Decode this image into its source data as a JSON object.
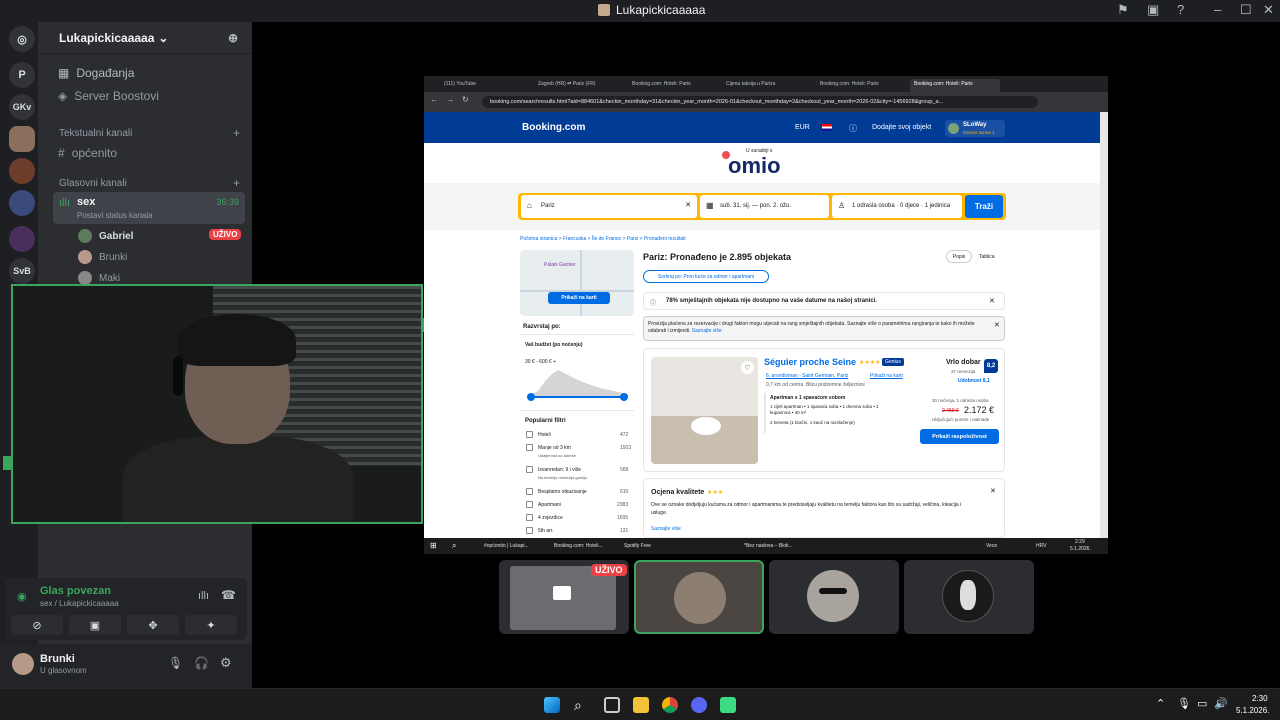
{
  "window": {
    "title": "Lukapickicaaaaa"
  },
  "servers": [
    "P",
    "GKv",
    "SvB"
  ],
  "guild": {
    "name": "Lukapickicaaaaa"
  },
  "channels": {
    "events": "Događanja",
    "boosts": "Server Boostovi",
    "text_category": "Tekstualni kanali",
    "text_channel": "općenito",
    "voice_category": "Glasovni kanali",
    "voice_channel": "sex",
    "voice_time": "36:39",
    "voice_status": "Postavi status kanala",
    "members": [
      {
        "name": "Gabriel",
        "badge": "UŽIVO"
      },
      {
        "name": "Brunki"
      },
      {
        "name": "Maki"
      }
    ]
  },
  "voice_panel": {
    "status": "Glas povezan",
    "location": "sex / Lukapickicaaaaa"
  },
  "user": {
    "name": "Brunki",
    "status": "U glasovnom"
  },
  "browser": {
    "tabs": [
      "(111) YouTube",
      "Zagreb (HR) ⇄ Pariz (FR)",
      "Booking.com: Hoteli: Paris",
      "Cijena taksija u Parizu",
      "Booking.com: Hoteli: Paris",
      "Booking.com: Hoteli: Paris"
    ],
    "url": "booking.com/searchresults.html?aid=884601&checkin_monthday=31&checkin_year_month=2026-01&checkout_monthday=2&checkout_year_month=2026-02&city=-1456928&group_a..."
  },
  "booking": {
    "logo": "Booking.com",
    "currency": "EUR",
    "list_property": "Dodajte svoj objekt",
    "account_name": "SLoWay",
    "account_level": "Genius razina 1",
    "partner_label": "U suradnji s",
    "partner_logo": "omio",
    "search": {
      "destination": "Pariz",
      "dates": "sub. 31. sij.  —  pon. 2. ožu.",
      "guests": "1 odrasla osoba · 0 djece · 1 jedinica",
      "submit": "Traži"
    },
    "breadcrumb": "Početna stranica > Francuska > Île de France > Pariz > Pronađeni rezultati",
    "map_button": "Prikaži na karti",
    "map_label": "Palais Garnier",
    "results_title": "Pariz: Pronađeno je 2.895 objekata",
    "sort": "Sortiraj po: Prvo kuće za odmor i apartmani",
    "view_toggle": [
      "Popis",
      "Tablica"
    ],
    "alert": "78% smještajnih objekata nije dostupno na vaše datume na našoj stranici.",
    "notice": "Provizija plaćena za rezervacije i drugi faktori mogu utjecati na rang smještajnih objekata. Saznajte više o parametrima rangiranja te kako ih možete odabrati i izmijeniti.",
    "notice_link": "Saznajte više",
    "filters": {
      "heading": "Razvrstaj po:",
      "budget": "Vaš budžet (po noćenju)",
      "budget_range": "30 € - 600 € +",
      "popular": "Popularni filtri",
      "items": [
        {
          "label": "Hoteli",
          "count": "472"
        },
        {
          "label": "Manje od 3 km",
          "count": "1503",
          "sub": "Udaljenost od adrese"
        },
        {
          "label": "Izvanredan: 9 i više",
          "count": "568",
          "sub": "Na temelju recenzija gostiju"
        },
        {
          "label": "Besplatno otkazivanje",
          "count": "610"
        },
        {
          "label": "Apartmani",
          "count": "2383"
        },
        {
          "label": "4 zvjezdice",
          "count": "1695"
        },
        {
          "label": "5th arr.",
          "count": "131"
        }
      ]
    },
    "property": {
      "name": "Séguier proche Seine",
      "genius": "Genius",
      "address": "6. arondisman - Saint Germain, Pariz",
      "map_link": "Prikaži na karti",
      "distance": "0,7 km od centra",
      "transit": "Blizu podzemne željeznice",
      "room": "Apartman s 1 spavaćom sobom",
      "details": "1 cijeli apartman • 1 spavaća soba • 1 dnevna soba • 1 kupaonica • 40 m²",
      "beds": "2 kreveta (1 bračni, 1 kauč na razvlačenje)",
      "rating_word": "Vrlo dobar",
      "reviews": "37 recenzija",
      "score": "8,2",
      "location_score": "Udobnost 8,1",
      "stay": "30 noćenja, 1 odrasla osoba",
      "old_price": "2.459 €",
      "price": "2.172 €",
      "taxes": "Uključujući poreze i naknade",
      "cta": "Prikaži raspoloživost"
    },
    "quality": {
      "title": "Ocjena kvalitete",
      "text": "Ove se oznake dodjeljuju kućama za odmor i apartmanima te predstavljaju kvalitetu na temelju faktora kao što su sadržaji, veličina, lokacija i usluge.",
      "link": "Saznajte više"
    }
  },
  "inner_taskbar": {
    "items": [
      "#općenito | Lukapi...",
      "Booking.com: Hoteli...",
      "Spotify Free",
      "*Bez naslova – Blok..."
    ],
    "weather": "Vece",
    "lang": "HRV",
    "time": "2:29",
    "date": "5.1.2026."
  },
  "thumb_badge": "UŽIVO",
  "taskbar": {
    "time": "2:30",
    "date": "5.1.2026."
  },
  "colors": {
    "discord_green": "#3ba55d",
    "booking_blue": "#003b95",
    "booking_yellow": "#ffb700",
    "live_red": "#ed4245"
  }
}
